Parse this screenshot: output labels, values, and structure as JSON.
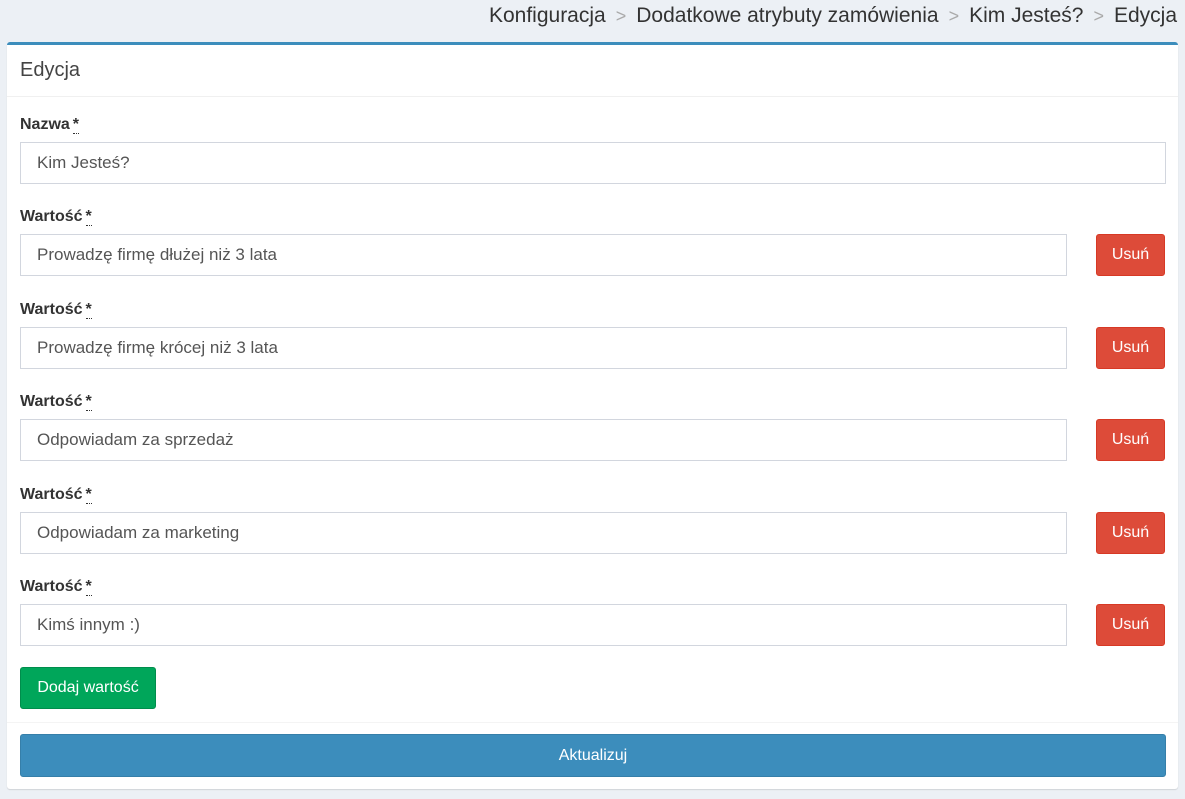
{
  "breadcrumb": {
    "items": [
      "Konfiguracja",
      "Dodatkowe atrybuty zamówienia",
      "Kim Jesteś?",
      "Edycja"
    ],
    "separator": ">"
  },
  "box": {
    "title": "Edycja"
  },
  "form": {
    "required_mark": "*",
    "name_label": "Nazwa",
    "name_value": "Kim Jesteś?",
    "value_label": "Wartość",
    "values": [
      "Prowadzę firmę dłużej niż 3 lata",
      "Prowadzę firmę krócej niż 3 lata",
      "Odpowiadam za sprzedaż",
      "Odpowiadam za marketing",
      "Kimś innym :)"
    ],
    "remove_label": "Usuń",
    "add_label": "Dodaj wartość",
    "update_label": "Aktualizuj"
  },
  "colors": {
    "primary": "#3c8dbc",
    "danger": "#dd4b39",
    "success": "#00a65a",
    "background": "#ecf0f5"
  }
}
